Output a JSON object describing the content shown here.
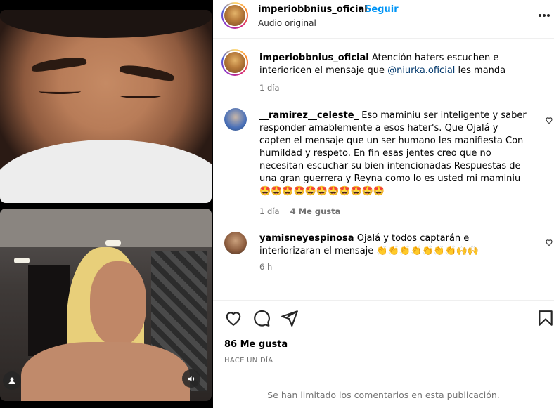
{
  "post": {
    "username": "imperiobbnius_oficial",
    "separator": "•",
    "follow_label": "Seguir",
    "audio_label": "Audio original",
    "more_icon": "more-horizontal-icon"
  },
  "caption": {
    "username": "imperiobbnius_oficial",
    "text_before": "Atención haters escuchen e interioricen el mensaje que ",
    "mention": "@niurka.oficial",
    "text_after": " les manda",
    "time": "1 día"
  },
  "comments": [
    {
      "username": "__ramirez__celeste_",
      "text": "Eso maminiu ser inteligente y saber responder amablemente a esos hater's. Que Ojalá y capten el mensaje que un ser humano les manifiesta Con humildad y respeto. En fin esas jentes creo que no necesitan escuchar su bien intencionadas Respuestas de una gran guerrera y Reyna como lo es usted mi maminiu 🤩🤩🤩🤩🤩🤩🤩🤩🤩🤩🤩",
      "time": "1 día",
      "likes": "4 Me gusta"
    },
    {
      "username": "yamisneyespinosa",
      "text": "Ojalá y todos captarán e interiorizaran el mensaje 👏👏👏👏👏👏👏🙌🙌",
      "time": "6 h"
    }
  ],
  "footer": {
    "likes": "86 Me gusta",
    "date": "HACE UN DÍA",
    "limited_notice": "Se han limitado los comentarios en esta publicación."
  },
  "icons": {
    "like": "heart-icon",
    "comment": "comment-icon",
    "share": "share-icon",
    "save": "bookmark-icon",
    "profile": "user-icon",
    "audio": "speaker-icon"
  }
}
